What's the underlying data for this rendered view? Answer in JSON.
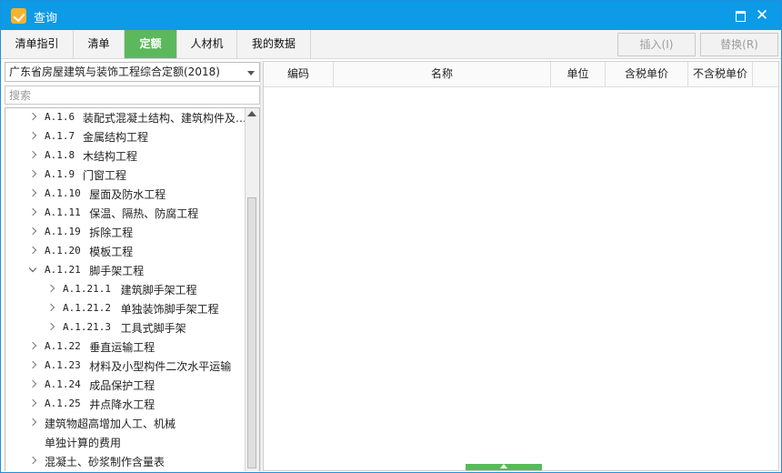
{
  "window": {
    "title": "查询"
  },
  "tabs": [
    "清单指引",
    "清单",
    "定额",
    "人材机",
    "我的数据"
  ],
  "active_tab": "定额",
  "toolbar": {
    "insert_label": "插入(I)",
    "replace_label": "替换(R)"
  },
  "quota_library": "广东省房屋建筑与装饰工程综合定额(2018)",
  "search": {
    "placeholder": "搜索",
    "value": ""
  },
  "tree": [
    {
      "code": "A.1.6",
      "label": "装配式混凝土结构、建筑构件及…",
      "level": 1,
      "expanded": false
    },
    {
      "code": "A.1.7",
      "label": "金属结构工程",
      "level": 1,
      "expanded": false
    },
    {
      "code": "A.1.8",
      "label": "木结构工程",
      "level": 1,
      "expanded": false
    },
    {
      "code": "A.1.9",
      "label": "门窗工程",
      "level": 1,
      "expanded": false
    },
    {
      "code": "A.1.10",
      "label": "屋面及防水工程",
      "level": 1,
      "expanded": false
    },
    {
      "code": "A.1.11",
      "label": "保温、隔热、防腐工程",
      "level": 1,
      "expanded": false
    },
    {
      "code": "A.1.19",
      "label": "拆除工程",
      "level": 1,
      "expanded": false
    },
    {
      "code": "A.1.20",
      "label": "模板工程",
      "level": 1,
      "expanded": false
    },
    {
      "code": "A.1.21",
      "label": "脚手架工程",
      "level": 1,
      "expanded": true
    },
    {
      "code": "A.1.21.1",
      "label": "建筑脚手架工程",
      "level": 2,
      "expanded": false
    },
    {
      "code": "A.1.21.2",
      "label": "单独装饰脚手架工程",
      "level": 2,
      "expanded": false
    },
    {
      "code": "A.1.21.3",
      "label": "工具式脚手架",
      "level": 2,
      "expanded": false
    },
    {
      "code": "A.1.22",
      "label": "垂直运输工程",
      "level": 1,
      "expanded": false
    },
    {
      "code": "A.1.23",
      "label": "材料及小型构件二次水平运输",
      "level": 1,
      "expanded": false
    },
    {
      "code": "A.1.24",
      "label": "成品保护工程",
      "level": 1,
      "expanded": false
    },
    {
      "code": "A.1.25",
      "label": "井点降水工程",
      "level": 1,
      "expanded": false
    },
    {
      "code": "",
      "label": "建筑物超高增加人工、机械",
      "level": 1,
      "expanded": false
    },
    {
      "code": "",
      "label": "单独计算的费用",
      "level": 1,
      "expanded": false,
      "leaf": true
    },
    {
      "code": "",
      "label": "混凝土、砂浆制作含量表",
      "level": 1,
      "expanded": false
    }
  ],
  "table": {
    "columns": [
      "编码",
      "名称",
      "单位",
      "含税单价",
      "不含税单价"
    ],
    "rows": []
  },
  "colors": {
    "title_bar": "#0d9ae7",
    "active_tab": "#5cb85c",
    "accent": "#5cb85c"
  },
  "icons": {
    "app": "app-icon",
    "maximize": "maximize-icon",
    "close": "close-icon",
    "dropdown": "chevron-down-icon",
    "tree_collapsed": "chevron-right-icon",
    "tree_expanded": "chevron-down-icon",
    "scroll_up": "scroll-up-icon"
  }
}
